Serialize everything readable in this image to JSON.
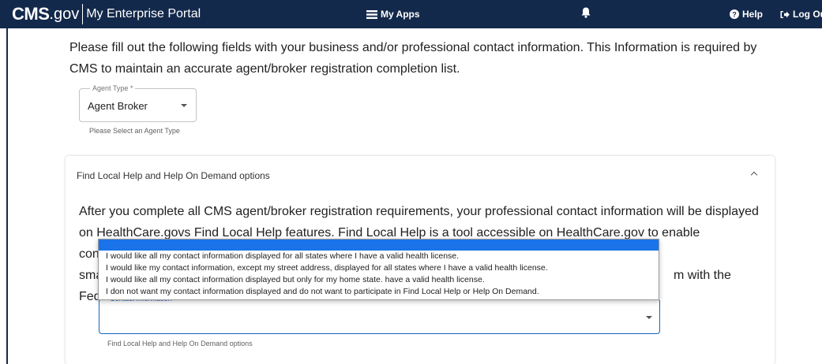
{
  "nav": {
    "brand_cms": "CMS",
    "brand_gov": ".gov",
    "portal": "My Enterprise Portal",
    "my_apps": "My Apps",
    "help": "Help",
    "logout": "Log Ou"
  },
  "intro_text": "Please fill out the following fields with your business and/or professional contact information. This Information is required by CMS to maintain an accurate agent/broker registration completion list.",
  "agent_type": {
    "label": "Agent Type *",
    "value": "Agent Broker",
    "helper": "Please Select an Agent Type"
  },
  "accordion": {
    "title": "Find Local Help and Help On Demand options",
    "body_line1": "After you complete all CMS agent/broker registration requirements, your professional contact information will be displayed",
    "body_line2": "on HealthCare.govs Find Local Help features. Find Local Help is a tool accessible on HealthCare.gov to enable consumers,",
    "body_line3_start": "sma",
    "body_line3_end": "m with the",
    "body_line4_start": "Fed"
  },
  "contact_info": {
    "label": "Contact Information",
    "value": "",
    "helper": "Find Local Help and Help On Demand options"
  },
  "dropdown_options": [
    "I would like all my contact information displayed for all states where I have a valid health license.",
    "I would like my contact information, except my street address, displayed for all states where I have a valid health license.",
    "I would like all my contact information displayed but only for my home state. have a valid health license.",
    "I don not want my contact information displayed and do not want to participate in Find Local Help or Help On Demand."
  ],
  "colors": {
    "navbar": "#13294b",
    "focus": "#1565c0",
    "menu_highlight": "#1a73e8"
  }
}
